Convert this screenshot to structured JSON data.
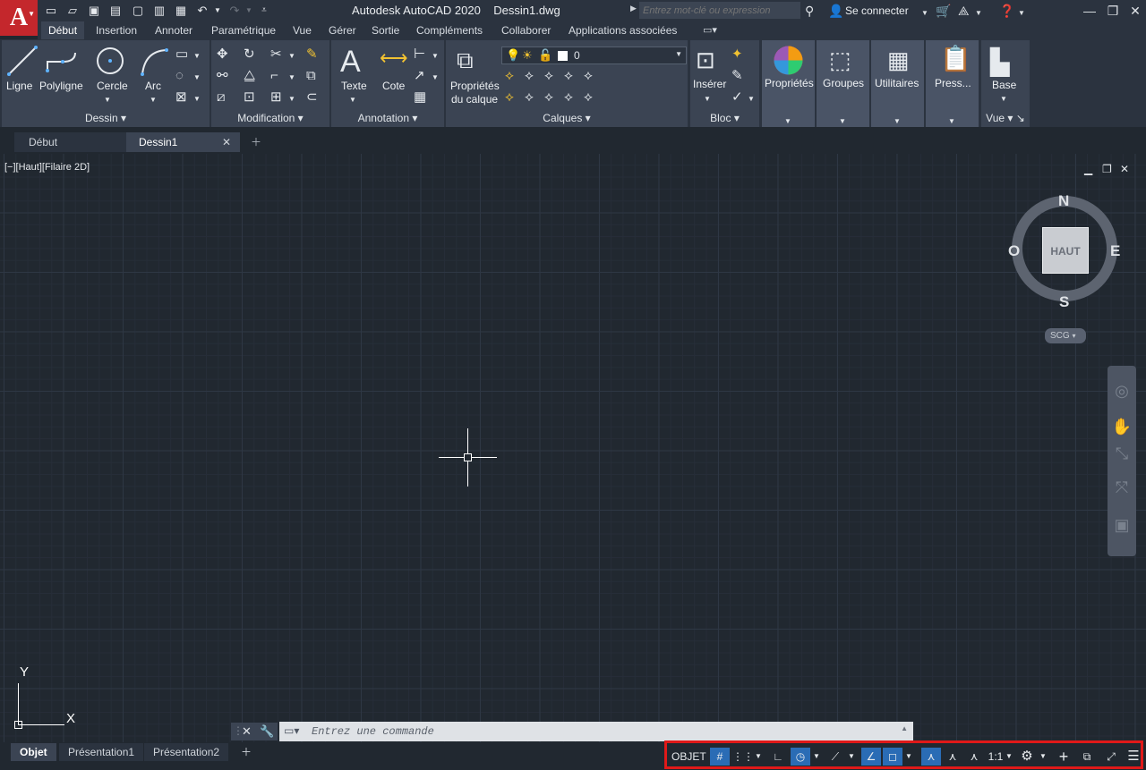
{
  "app": {
    "logo": "A",
    "title": "Autodesk AutoCAD 2020    Dessin1.dwg"
  },
  "search": {
    "placeholder": "Entrez mot-clé ou expression"
  },
  "account": {
    "signin_label": "Se connecter"
  },
  "ribbon_tabs": [
    "Début",
    "Insertion",
    "Annoter",
    "Paramétrique",
    "Vue",
    "Gérer",
    "Sortie",
    "Compléments",
    "Collaborer",
    "Applications associées"
  ],
  "panels": {
    "dessin": {
      "title": "Dessin",
      "tools": [
        "Ligne",
        "Polyligne",
        "Cercle",
        "Arc"
      ]
    },
    "modification": {
      "title": "Modification"
    },
    "annotation": {
      "title": "Annotation",
      "tools": [
        "Texte",
        "Cote"
      ]
    },
    "calques": {
      "title": "Calques",
      "layer_props_line1": "Propriétés",
      "layer_props_line2": "du calque",
      "current_layer": "0"
    },
    "bloc": {
      "title": "Bloc",
      "insert_label": "Insérer"
    },
    "proprietes": {
      "label": "Propriétés"
    },
    "groupes": {
      "label": "Groupes"
    },
    "utilitaires": {
      "label": "Utilitaires"
    },
    "presse": {
      "label": "Press..."
    },
    "vue": {
      "title": "Vue",
      "base_label": "Base"
    }
  },
  "doc_tabs": [
    "Début",
    "Dessin1"
  ],
  "viewport": {
    "label": "[−][Haut][Filaire 2D]"
  },
  "viewcube": {
    "face": "HAUT",
    "north": "N",
    "south": "S",
    "east": "E",
    "west": "O",
    "ucs_menu": "SCG"
  },
  "ucs": {
    "x_label": "X",
    "y_label": "Y"
  },
  "command": {
    "placeholder": "Entrez une commande"
  },
  "layout_tabs": [
    "Objet",
    "Présentation1",
    "Présentation2"
  ],
  "statusbar": {
    "model_label": "OBJET",
    "scale": "1:1"
  },
  "colors": {
    "logo": "#c4272c",
    "accent": "#2a6cb5",
    "highlight_border": "#e01919"
  }
}
